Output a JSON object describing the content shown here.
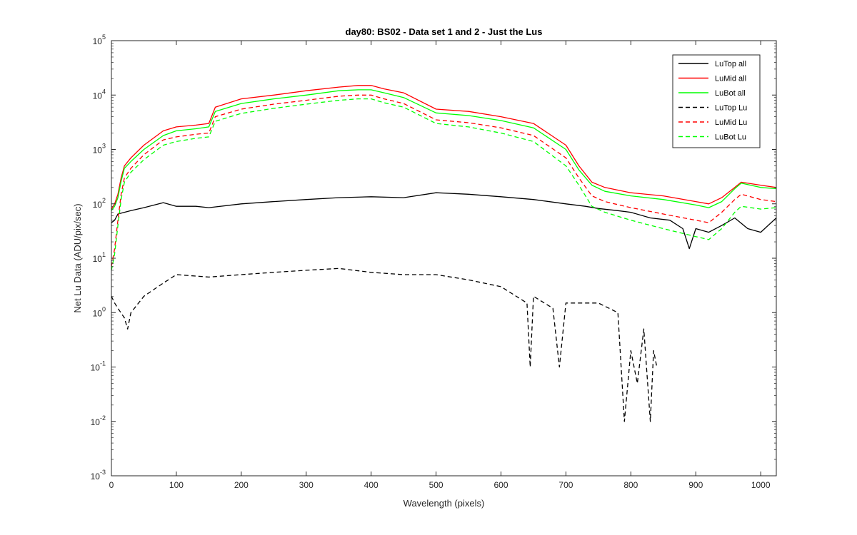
{
  "chart_data": {
    "type": "line",
    "title": "day80: BS02 - Data set 1 and 2 - Just the Lus",
    "xlabel": "Wavelength (pixels)",
    "ylabel": "Net Lu Data (ADU/pix/sec)",
    "xlim": [
      0,
      1024
    ],
    "ylim": [
      0.001,
      100000
    ],
    "yscale": "log",
    "grid": false,
    "legend_position": "top-right",
    "x_ticks": [
      "0",
      "100",
      "200",
      "300",
      "400",
      "500",
      "600",
      "700",
      "800",
      "900",
      "1000"
    ],
    "y_ticks": [
      {
        "base": "10",
        "exp": "-3"
      },
      {
        "base": "10",
        "exp": "-2"
      },
      {
        "base": "10",
        "exp": "-1"
      },
      {
        "base": "10",
        "exp": "0"
      },
      {
        "base": "10",
        "exp": "1"
      },
      {
        "base": "10",
        "exp": "2"
      },
      {
        "base": "10",
        "exp": "3"
      },
      {
        "base": "10",
        "exp": "4"
      },
      {
        "base": "10",
        "exp": "5"
      }
    ],
    "series": [
      {
        "name": "LuTop  all",
        "color": "#000000",
        "style": "solid",
        "x": [
          0,
          5,
          10,
          20,
          30,
          50,
          80,
          100,
          130,
          150,
          200,
          250,
          300,
          350,
          400,
          450,
          500,
          550,
          600,
          650,
          700,
          730,
          750,
          780,
          800,
          830,
          860,
          880,
          890,
          900,
          920,
          940,
          960,
          980,
          1000,
          1024
        ],
        "y": [
          45,
          50,
          65,
          70,
          75,
          85,
          105,
          90,
          90,
          85,
          100,
          110,
          120,
          130,
          135,
          130,
          160,
          150,
          135,
          120,
          100,
          90,
          82,
          75,
          70,
          55,
          50,
          35,
          15,
          35,
          30,
          40,
          55,
          35,
          30,
          55
        ]
      },
      {
        "name": "LuMid  all",
        "color": "#ff0000",
        "style": "solid",
        "x": [
          0,
          5,
          10,
          15,
          20,
          30,
          50,
          80,
          100,
          130,
          150,
          160,
          200,
          250,
          300,
          350,
          380,
          400,
          420,
          450,
          500,
          550,
          600,
          650,
          700,
          720,
          740,
          760,
          800,
          850,
          900,
          920,
          940,
          960,
          970,
          1000,
          1024
        ],
        "y": [
          80,
          100,
          150,
          300,
          500,
          700,
          1200,
          2200,
          2600,
          2800,
          3000,
          6000,
          8500,
          10000,
          12000,
          14000,
          15000,
          15000,
          13000,
          11000,
          5500,
          5000,
          4000,
          3000,
          1200,
          500,
          250,
          200,
          160,
          140,
          110,
          100,
          130,
          200,
          250,
          220,
          200
        ]
      },
      {
        "name": "LuBot  all",
        "color": "#00ff00",
        "style": "solid",
        "x": [
          0,
          5,
          10,
          15,
          20,
          30,
          50,
          80,
          100,
          130,
          150,
          160,
          200,
          250,
          300,
          350,
          380,
          400,
          420,
          450,
          500,
          550,
          600,
          650,
          700,
          720,
          740,
          760,
          800,
          850,
          900,
          920,
          940,
          960,
          970,
          1000,
          1024
        ],
        "y": [
          75,
          90,
          130,
          260,
          450,
          600,
          1000,
          1800,
          2200,
          2400,
          2600,
          5000,
          7000,
          8500,
          10000,
          12000,
          12500,
          12500,
          11000,
          9000,
          4700,
          4200,
          3400,
          2500,
          1000,
          420,
          220,
          170,
          140,
          120,
          95,
          85,
          110,
          190,
          240,
          200,
          190
        ]
      },
      {
        "name": "LuTop  Lu",
        "color": "#000000",
        "style": "dashed",
        "x": [
          0,
          5,
          10,
          20,
          25,
          30,
          50,
          80,
          100,
          150,
          200,
          250,
          300,
          350,
          400,
          450,
          500,
          550,
          600,
          640,
          645,
          650,
          680,
          690,
          700,
          750,
          780,
          790,
          800,
          810,
          820,
          830,
          835,
          840
        ],
        "y": [
          2,
          1.5,
          1.2,
          0.8,
          0.5,
          1.0,
          2.0,
          3.5,
          5.0,
          4.5,
          5.0,
          5.5,
          6.0,
          6.5,
          5.5,
          5.0,
          5.0,
          4.0,
          3.0,
          1.5,
          0.1,
          2.0,
          1.2,
          0.1,
          1.5,
          1.5,
          1.0,
          0.01,
          0.2,
          0.05,
          0.5,
          0.01,
          0.2,
          0.1
        ]
      },
      {
        "name": "LuMid  Lu",
        "color": "#ff0000",
        "style": "dashed",
        "x": [
          0,
          5,
          10,
          15,
          20,
          30,
          50,
          80,
          100,
          130,
          150,
          160,
          200,
          250,
          300,
          350,
          380,
          400,
          420,
          450,
          500,
          550,
          600,
          650,
          700,
          720,
          740,
          760,
          800,
          850,
          900,
          920,
          940,
          960,
          970,
          1000,
          1024
        ],
        "y": [
          7,
          15,
          50,
          150,
          300,
          450,
          800,
          1500,
          1700,
          1900,
          2000,
          4000,
          5500,
          6800,
          8000,
          9500,
          10000,
          10000,
          8500,
          7000,
          3500,
          3100,
          2500,
          1800,
          700,
          300,
          140,
          110,
          85,
          65,
          50,
          45,
          70,
          120,
          150,
          120,
          110
        ]
      },
      {
        "name": "LuBot  Lu",
        "color": "#00ff00",
        "style": "dashed",
        "x": [
          0,
          5,
          10,
          15,
          20,
          30,
          50,
          80,
          100,
          130,
          150,
          160,
          200,
          250,
          300,
          350,
          380,
          400,
          420,
          450,
          500,
          550,
          600,
          650,
          700,
          720,
          740,
          760,
          800,
          850,
          900,
          920,
          940,
          960,
          970,
          1000,
          1024
        ],
        "y": [
          6,
          12,
          40,
          120,
          250,
          380,
          650,
          1200,
          1400,
          1600,
          1700,
          3300,
          4600,
          5700,
          6800,
          8000,
          8500,
          8500,
          7200,
          6000,
          3000,
          2600,
          2000,
          1400,
          500,
          220,
          90,
          70,
          50,
          35,
          25,
          22,
          35,
          70,
          90,
          80,
          85
        ]
      }
    ]
  }
}
